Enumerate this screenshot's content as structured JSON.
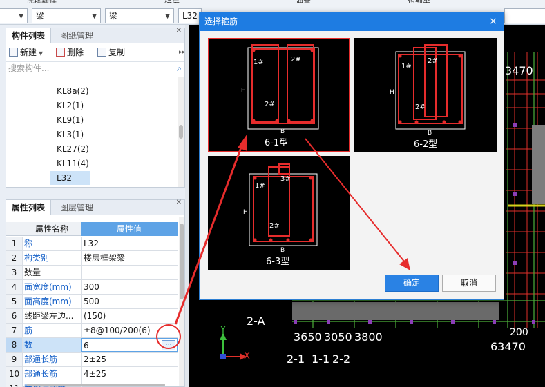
{
  "toolbar": {
    "cut_labels": [
      "选择插件",
      "楼层",
      "通常",
      "识别梁"
    ],
    "combos": [
      {
        "value": ""
      },
      {
        "value": "梁"
      },
      {
        "value": "梁"
      },
      {
        "value": "L32"
      }
    ]
  },
  "component_panel": {
    "tabs": [
      "构件列表",
      "图纸管理"
    ],
    "buttons": {
      "new": "新建",
      "delete": "删除",
      "copy": "复制"
    },
    "search_placeholder": "搜索构件...",
    "items": [
      "KL8a(2)",
      "KL2(1)",
      "KL9(1)",
      "KL3(1)",
      "KL27(2)",
      "KL11(4)",
      "L32"
    ],
    "selected_item": "L32"
  },
  "property_panel": {
    "tabs": [
      "属性列表",
      "图层管理"
    ],
    "header": {
      "name": "属性名称",
      "value": "属性值"
    },
    "rows": [
      {
        "num": "1",
        "name": "称",
        "value": "L32",
        "blue": true
      },
      {
        "num": "2",
        "name": "构类别",
        "value": "楼层框架梁",
        "blue": true
      },
      {
        "num": "3",
        "name": "数量",
        "value": "",
        "blue": false
      },
      {
        "num": "4",
        "name": "面宽度(mm)",
        "value": "300",
        "blue": true
      },
      {
        "num": "5",
        "name": "面高度(mm)",
        "value": "500",
        "blue": true
      },
      {
        "num": "6",
        "name": "线距梁左边...",
        "value": "(150)",
        "blue": false
      },
      {
        "num": "7",
        "name": "筋",
        "value": "±8@100/200(6)",
        "blue": true
      },
      {
        "num": "8",
        "name": "数",
        "value": "6",
        "blue": true
      },
      {
        "num": "9",
        "name": "部通长筋",
        "value": "2±25",
        "blue": true
      },
      {
        "num": "10",
        "name": "部通长筋",
        "value": "4±25",
        "blue": true
      },
      {
        "num": "11",
        "name": "面构造或受...",
        "value": "",
        "blue": true
      }
    ],
    "selected_row": "8"
  },
  "dialog": {
    "title": "选择箍筋",
    "close": "×",
    "stirrup_types": [
      {
        "label": "6-1型",
        "tags": [
          "1#",
          "2#",
          "2#"
        ],
        "selected": true
      },
      {
        "label": "6-2型",
        "tags": [
          "1#",
          "2#",
          "2#"
        ],
        "selected": false
      },
      {
        "label": "6-3型",
        "tags": [
          "1#",
          "3#",
          "2#"
        ],
        "selected": false
      }
    ],
    "dim_h": "H",
    "dim_b": "B",
    "ok_label": "确定",
    "cancel_label": "取消"
  },
  "canvas": {
    "axis_labels": [
      "2-A",
      "2-1",
      "1-1",
      "2-2"
    ],
    "dimension_texts": [
      "3650",
      "3050",
      "3800",
      "63470",
      "200",
      "3470"
    ],
    "coord_x": "X",
    "coord_y": "Y"
  },
  "colors": {
    "accent_blue": "#1e7ce2",
    "highlight_red": "#e62c2c",
    "cad_green": "#4caf3a",
    "cad_yellow": "#d6d31a"
  }
}
